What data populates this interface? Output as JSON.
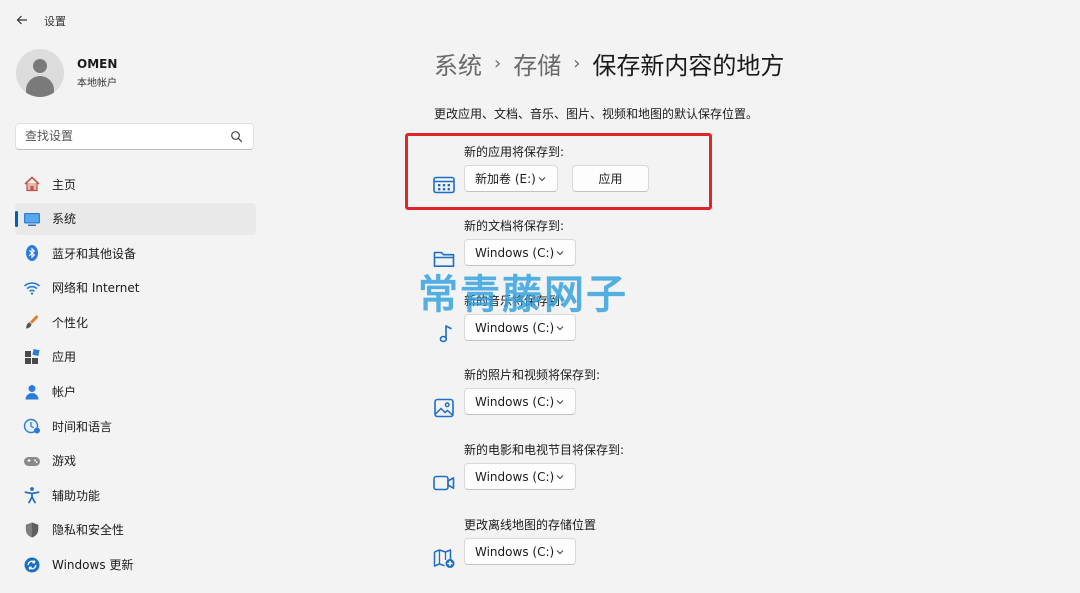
{
  "app": {
    "title": "设置"
  },
  "profile": {
    "name": "OMEN",
    "account_type": "本地帐户"
  },
  "search": {
    "placeholder": "查找设置"
  },
  "sidebar": {
    "items": [
      {
        "label": "主页",
        "icon": "home-icon",
        "active": false
      },
      {
        "label": "系统",
        "icon": "system-icon",
        "active": true
      },
      {
        "label": "蓝牙和其他设备",
        "icon": "bluetooth-icon",
        "active": false
      },
      {
        "label": "网络和 Internet",
        "icon": "wifi-icon",
        "active": false
      },
      {
        "label": "个性化",
        "icon": "brush-icon",
        "active": false
      },
      {
        "label": "应用",
        "icon": "apps-icon",
        "active": false
      },
      {
        "label": "帐户",
        "icon": "account-icon",
        "active": false
      },
      {
        "label": "时间和语言",
        "icon": "time-language-icon",
        "active": false
      },
      {
        "label": "游戏",
        "icon": "gamepad-icon",
        "active": false
      },
      {
        "label": "辅助功能",
        "icon": "accessibility-icon",
        "active": false
      },
      {
        "label": "隐私和安全性",
        "icon": "shield-icon",
        "active": false
      },
      {
        "label": "Windows 更新",
        "icon": "windows-update-icon",
        "active": false
      }
    ]
  },
  "breadcrumb": {
    "level1": "系统",
    "level2": "存储",
    "current": "保存新内容的地方"
  },
  "description": "更改应用、文档、音乐、图片、视频和地图的默认保存位置。",
  "locations": [
    {
      "label": "新的应用将保存到:",
      "icon": "app-window-icon",
      "value": "新加卷 (E:)",
      "apply_label": "应用"
    },
    {
      "label": "新的文档将保存到:",
      "icon": "folder-icon",
      "value": "Windows (C:)"
    },
    {
      "label": "新的音乐将保存到:",
      "icon": "music-note-icon",
      "value": "Windows (C:)"
    },
    {
      "label": "新的照片和视频将保存到:",
      "icon": "picture-icon",
      "value": "Windows (C:)"
    },
    {
      "label": "新的电影和电视节目将保存到:",
      "icon": "video-camera-icon",
      "value": "Windows (C:)"
    },
    {
      "label": "更改离线地图的存储位置",
      "icon": "map-icon",
      "value": "Windows (C:)"
    }
  ],
  "watermark": "常青藤网子",
  "colors": {
    "accent": "#005fb8",
    "highlight": "#e0262b",
    "background": "#f3f3f3"
  }
}
